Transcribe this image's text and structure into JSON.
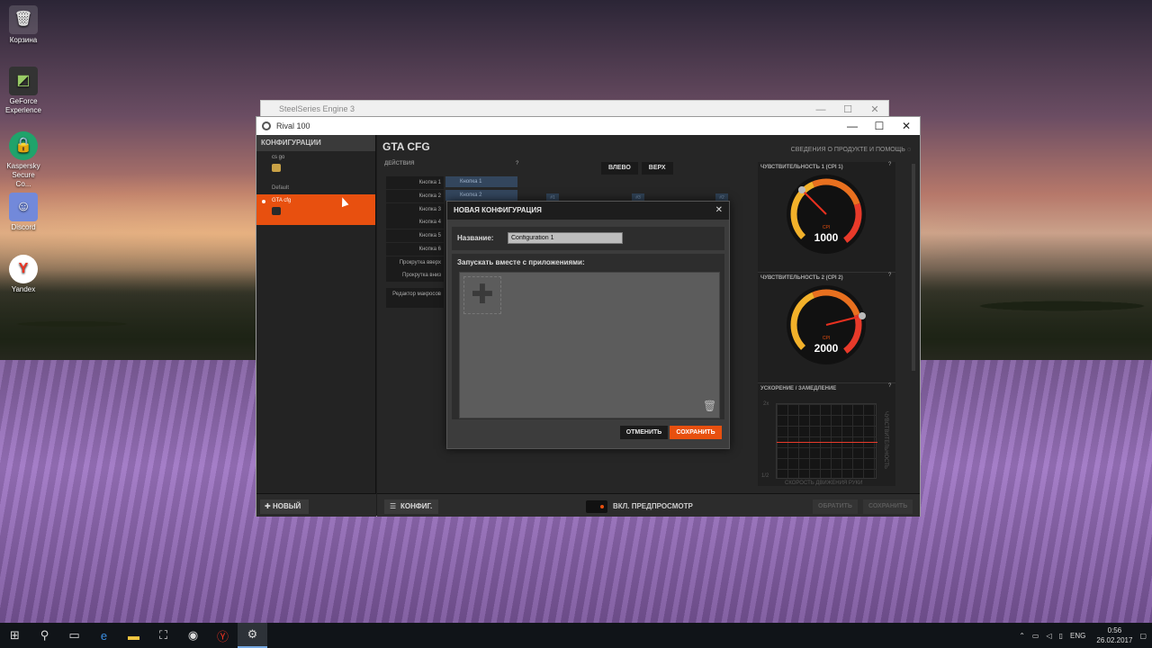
{
  "desktop": {
    "icons": [
      {
        "label": "Корзина"
      },
      {
        "label": "GeForce Experience"
      },
      {
        "label": "Kaspersky Secure Co..."
      },
      {
        "label": "Discord"
      },
      {
        "label": "Yandex"
      }
    ]
  },
  "back_window": {
    "title": "SteelSeries Engine 3"
  },
  "window": {
    "title": "Rival 100",
    "sidebar": {
      "header": "КОНФИГУРАЦИИ",
      "configs": [
        {
          "name": "cs go"
        },
        {
          "name": "Default"
        },
        {
          "name": "GTA cfg"
        }
      ],
      "new_button": "НОВЫЙ"
    },
    "main": {
      "title": "GTA CFG",
      "info_link": "СВЕДЕНИЯ О ПРОДУКТЕ И ПОМОЩЬ",
      "actions_header": "ДЕЙСТВИЯ",
      "actions": [
        "Кнопка 1",
        "Кнопка 2",
        "Кнопка 3",
        "Кнопка 4",
        "Кнопка 5",
        "Кнопка 6",
        "Прокрутка вверх",
        "Прокрутка вниз",
        "Редактор макросов"
      ],
      "assigned": [
        "Кнопка 1",
        "Кнопка 2"
      ],
      "view_buttons": [
        "ВЛЕВО",
        "ВЕРХ"
      ],
      "button_markers": [
        "#1",
        "#3",
        "#2"
      ],
      "sensitivity1": {
        "title": "ЧУВСТВИТЕЛЬНОСТЬ 1 (CPI 1)",
        "label": "CPI",
        "value": "1000"
      },
      "sensitivity2": {
        "title": "ЧУВСТВИТЕЛЬНОСТЬ 2 (CPI 2)",
        "label": "CPI",
        "value": "2000"
      },
      "acceleration": {
        "title": "УСКОРЕНИЕ / ЗАМЕДЛЕНИЕ",
        "y_label": "ЧУВСТВИТЕЛЬНОСТЬ",
        "x_label": "СКОРОСТЬ ДВИЖЕНИЯ РУКИ",
        "top_tick": "2x",
        "bottom_tick": "1/2"
      },
      "help": "?",
      "footer": {
        "config_button": "КОНФИГ.",
        "preview_label": "ВКЛ. ПРЕДПРОСМОТР",
        "revert_button": "ОБРАТИТЬ",
        "save_button": "СОХРАНИТЬ"
      }
    }
  },
  "modal": {
    "title": "НОВАЯ КОНФИГУРАЦИЯ",
    "name_label": "Название:",
    "name_value": "Configuration 1",
    "apps_label": "Запускать вместе с приложениями:",
    "cancel": "ОТМЕНИТЬ",
    "save": "СОХРАНИТЬ"
  },
  "taskbar": {
    "lang": "ENG",
    "time": "0:56",
    "date": "26.02.2017"
  },
  "colors": {
    "accent": "#e8500f",
    "panel": "#262626"
  }
}
